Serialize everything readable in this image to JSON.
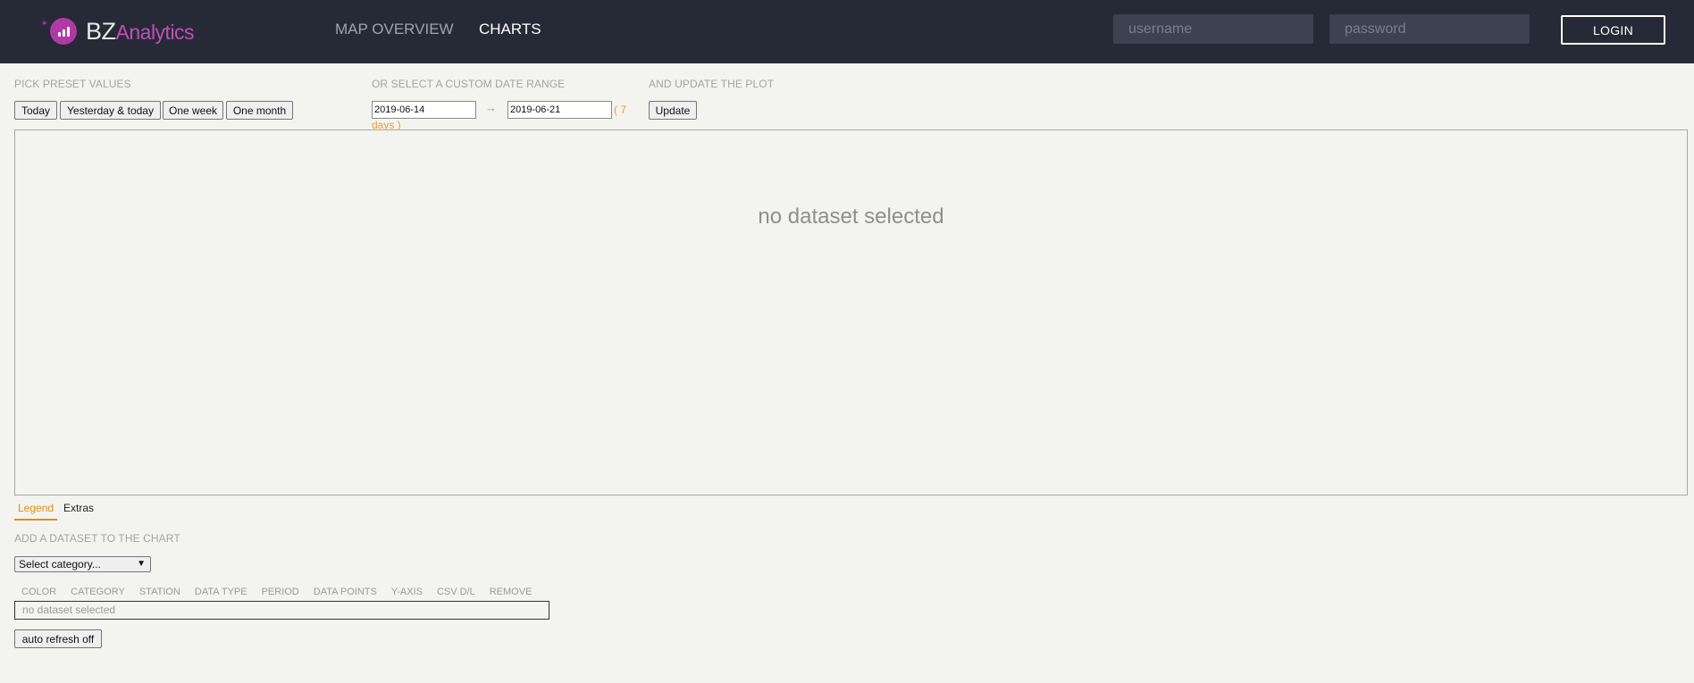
{
  "header": {
    "logo": {
      "bz": "BZ",
      "analytics": "Analytics",
      "icon": "bar-chart-icon"
    },
    "nav": {
      "map_overview": "MAP OVERVIEW",
      "charts": "CHARTS"
    },
    "username_placeholder": "username",
    "password_placeholder": "password",
    "login_label": "LOGIN"
  },
  "controls": {
    "preset_label": "PICK PRESET VALUES",
    "presets": [
      "Today",
      "Yesterday & today",
      "One week",
      "One month"
    ],
    "custom_label": "OR SELECT A CUSTOM DATE RANGE",
    "date_from": "2019-06-14",
    "date_to": "2019-06-21",
    "arrow": "→",
    "days_note": "( 7 days )",
    "update_label": "AND UPDATE THE PLOT",
    "update_button": "Update"
  },
  "chart": {
    "empty_message": "no dataset selected"
  },
  "tabs": [
    "Legend",
    "Extras"
  ],
  "legend": {
    "add_label": "ADD A DATASET TO THE CHART",
    "category_select": "Select category...",
    "columns": [
      "COLOR",
      "CATEGORY",
      "STATION",
      "DATA TYPE",
      "PERIOD",
      "DATA POINTS",
      "Y-AXIS",
      "CSV D/L",
      "REMOVE"
    ],
    "empty_row": "no dataset selected",
    "auto_refresh": "auto refresh off"
  },
  "colors": {
    "header_bg": "#262a36",
    "accent": "#e58a14",
    "brand": "#b03aa5",
    "page_bg": "#f3f4f0"
  }
}
